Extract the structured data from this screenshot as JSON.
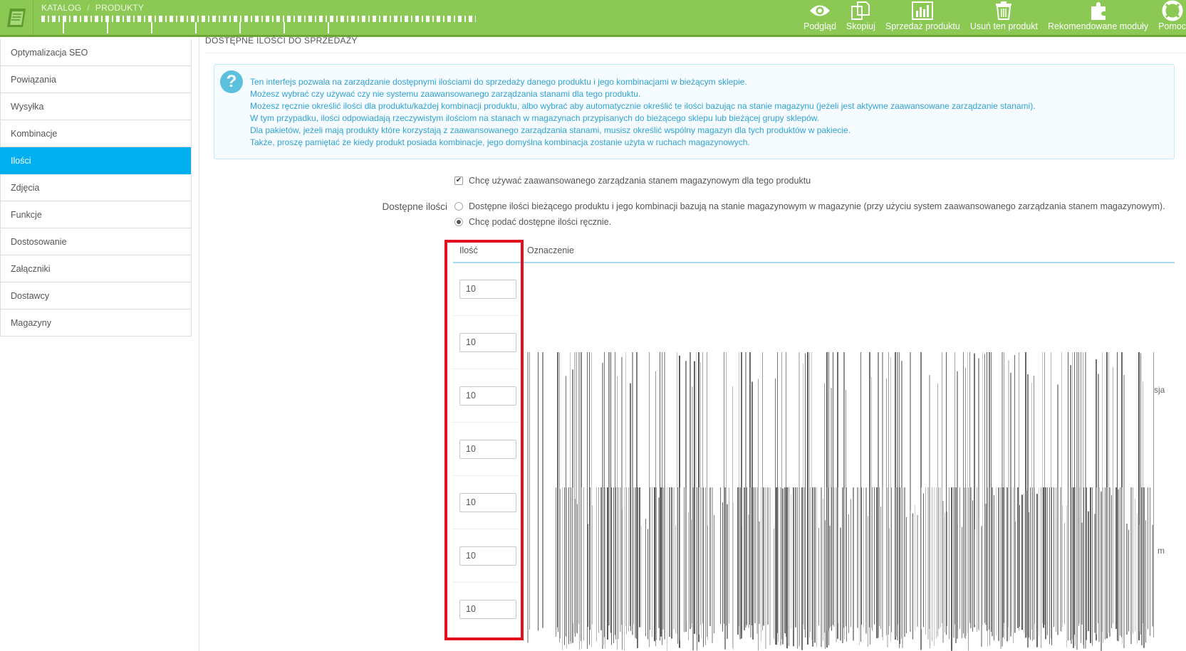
{
  "header": {
    "breadcrumb": [
      "KATALOG",
      "PRODUKTY"
    ],
    "toolbar": [
      {
        "name": "preview-button",
        "icon": "eye-icon",
        "label": "Podgląd"
      },
      {
        "name": "duplicate-button",
        "icon": "copy-icon",
        "label": "Skopiuj"
      },
      {
        "name": "sales-button",
        "icon": "bar-chart-icon",
        "label": "Sprzedaż produktu"
      },
      {
        "name": "delete-button",
        "icon": "trash-icon",
        "label": "Usuń ten produkt"
      },
      {
        "name": "modules-button",
        "icon": "puzzle-icon",
        "label": "Rekomendowane moduły"
      },
      {
        "name": "help-button",
        "icon": "lifebuoy-icon",
        "label": "Pomoc"
      }
    ]
  },
  "sidebar": {
    "items": [
      {
        "label": "Optymalizacja SEO",
        "active": false
      },
      {
        "label": "Powiązania",
        "active": false
      },
      {
        "label": "Wysyłka",
        "active": false
      },
      {
        "label": "Kombinacje",
        "active": false
      },
      {
        "label": "Ilości",
        "active": true
      },
      {
        "label": "Zdjęcia",
        "active": false
      },
      {
        "label": "Funkcje",
        "active": false
      },
      {
        "label": "Dostosowanie",
        "active": false
      },
      {
        "label": "Załączniki",
        "active": false
      },
      {
        "label": "Dostawcy",
        "active": false
      },
      {
        "label": "Magazyny",
        "active": false
      }
    ]
  },
  "panel": {
    "title": "DOSTĘPNE ILOŚCI DO SPRZEDAŻY",
    "info_lines": [
      "Ten interfejs pozwala na zarządzanie dostępnymi ilościami do sprzedaży danego produktu i jego kombinacjami w bieżącym sklepie.",
      "Możesz wybrać czy używać czy nie systemu zaawansowanego zarządzania stanami dla tego produktu.",
      "Możesz ręcznie określić ilości dla produktu/każdej kombinacji produktu, albo wybrać aby automatycznie określić te ilości bazując na stanie magazynu (jeżeli jest aktywne zaawansowane zarządzanie stanami).",
      "W tym przypadku, ilości odpowiadają rzeczywistym ilościom na stanach w magazynach przypisanych do bieżącego sklepu lub bieżącej grupy sklepów.",
      "Dla pakietów, jeżeli mają produkty które korzystają z zaawansowanego zarządzania stanami, musisz określić wspólny magazyn dla tych produktów w pakiecie.",
      "Także, proszę pamiętać że kiedy produkt posiada kombinacje, jego domyślna kombinacja zostanie użyta w ruchach magazynowych."
    ],
    "advanced_stock": {
      "checked": true,
      "label": "Chcę używać zaawansowanego zarządzania stanem magazynowym dla tego produktu"
    },
    "available_label": "Dostępne ilości",
    "radio_options": [
      {
        "label": "Dostępne ilości bieżącego produktu i jego kombinacji bazują na stanie magazynowym w magazynie (przy użyciu system zaawansowanego zarządzania stanem magazynowym).",
        "selected": false
      },
      {
        "label": "Chcę podać dostępne ilości ręcznie.",
        "selected": true
      }
    ],
    "table": {
      "headers": {
        "qty": "Ilość",
        "label": "Oznaczenie"
      },
      "rows": [
        "10",
        "10",
        "10",
        "10",
        "10",
        "10",
        "10"
      ]
    },
    "glitch_fragments": {
      "a": "sja",
      "b": "m"
    }
  }
}
